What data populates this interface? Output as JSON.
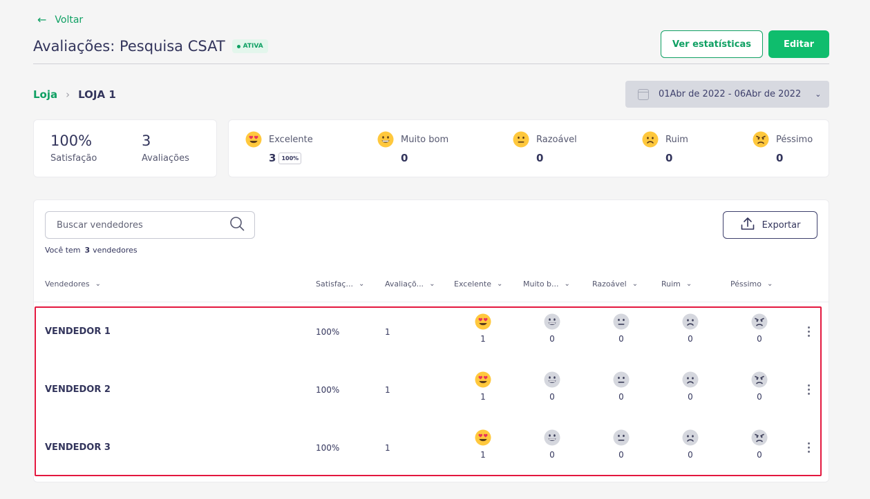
{
  "header": {
    "back_label": "Voltar",
    "title": "Avaliações: Pesquisa CSAT",
    "status": "ATIVA",
    "stats_button": "Ver estatísticas",
    "edit_button": "Editar"
  },
  "breadcrumb": {
    "parent": "Loja",
    "current": "LOJA 1"
  },
  "date_range": "01Abr de 2022 - 06Abr de 2022",
  "summary": {
    "satisfaction_value": "100%",
    "satisfaction_label": "Satisfação",
    "reviews_value": "3",
    "reviews_label": "Avaliações"
  },
  "ratings": [
    {
      "label": "Excelente",
      "count": "3",
      "percent": "100%",
      "icon": "excellent-emoji-icon"
    },
    {
      "label": "Muito bom",
      "count": "0",
      "icon": "very-good-emoji-icon"
    },
    {
      "label": "Razoável",
      "count": "0",
      "icon": "neutral-emoji-icon"
    },
    {
      "label": "Ruim",
      "count": "0",
      "icon": "sad-emoji-icon"
    },
    {
      "label": "Péssimo",
      "count": "0",
      "icon": "angry-emoji-icon"
    }
  ],
  "table": {
    "search_placeholder": "Buscar vendedores",
    "export_label": "Exportar",
    "count_prefix": "Você tem",
    "count_value": "3",
    "count_suffix": "vendedores",
    "columns": [
      "Vendedores",
      "Satisfaç...",
      "Avaliaçõ...",
      "Excelente",
      "Muito b...",
      "Razoável",
      "Ruim",
      "Péssimo"
    ],
    "rows": [
      {
        "name": "VENDEDOR 1",
        "satisfaction": "100%",
        "reviews": "1",
        "excellent": "1",
        "very_good": "0",
        "neutral": "0",
        "bad": "0",
        "terrible": "0"
      },
      {
        "name": "VENDEDOR 2",
        "satisfaction": "100%",
        "reviews": "1",
        "excellent": "1",
        "very_good": "0",
        "neutral": "0",
        "bad": "0",
        "terrible": "0"
      },
      {
        "name": "VENDEDOR 3",
        "satisfaction": "100%",
        "reviews": "1",
        "excellent": "1",
        "very_good": "0",
        "neutral": "0",
        "bad": "0",
        "terrible": "0"
      }
    ]
  },
  "colors": {
    "brand_green": "#0fbd6d",
    "text_navy": "#33355c",
    "highlight_red": "#e3173e",
    "emoji_yellow": "#ffd23f",
    "emoji_gray": "#d5d7de"
  }
}
